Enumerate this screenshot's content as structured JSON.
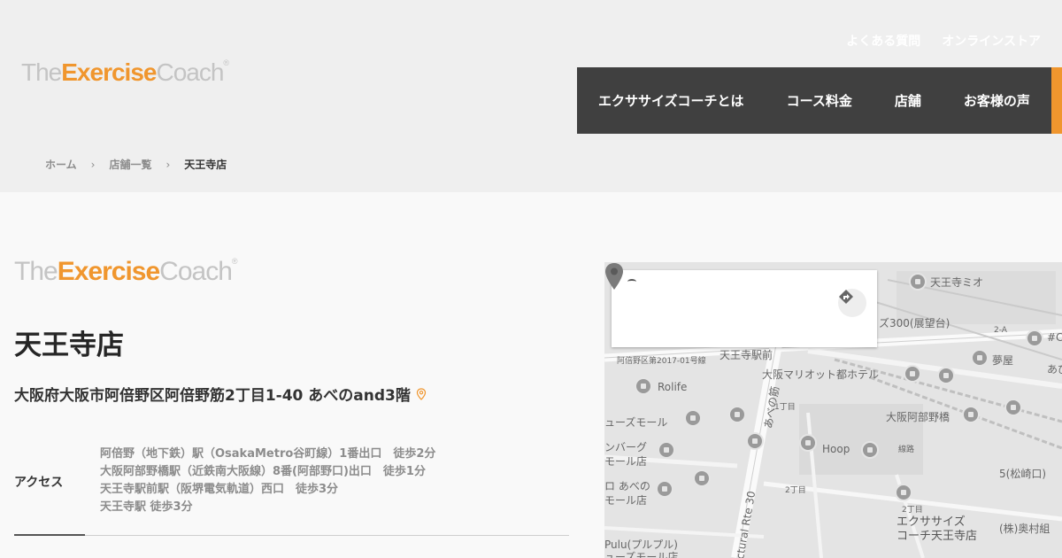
{
  "brand": {
    "the": "The",
    "exercise": "Exercise",
    "coach": "Coach",
    "reg": "®"
  },
  "util_nav": [
    "よくある質問",
    "オンラインストア"
  ],
  "main_nav": [
    "エクササイズコーチとは",
    "コース料金",
    "店舗",
    "お客様の声"
  ],
  "breadcrumb": {
    "home": "ホーム",
    "list": "店舗一覧",
    "current": "天王寺店",
    "sep": "›"
  },
  "store": {
    "name": "天王寺店",
    "address": "大阪府大阪市阿倍野区阿倍野筋2丁目1-40 あべのand3階",
    "access_label": "アクセス",
    "access": [
      "阿倍野（地下鉄）駅（OsakaMetro谷町線）1番出口　徒歩2分",
      "大阪阿部野橋駅（近鉄南大阪線）8番(阿部野口)出口　徒歩1分",
      "天王寺駅前駅（阪堺電気軌道）西口　徒歩3分",
      "天王寺駅 徒歩3分"
    ]
  },
  "map": {
    "labels": {
      "tennoji_mio": "天王寺ミオ",
      "tenbodai": "ズ300(展望台)",
      "a2": "2-A",
      "a1": "#C",
      "yumeya": "夢屋",
      "abeno": "あび",
      "area_code": "阿倍野区第2017-01号線",
      "tennoji_ekimae": "天王寺駅前",
      "marriott": "大阪マリオット都ホテル",
      "rolife": "Rolife",
      "mall": "ューズモール",
      "itchome": "1丁目",
      "abenobashi": "大阪阿部野橋",
      "burger": "ンバーグ",
      "mall_store": "モール店",
      "hoop": "Hoop",
      "abenosuji": "あべの筋",
      "senro": "線路",
      "ko_abeno": "ロ あべの",
      "mall_store2": "モール店",
      "matsusakiguchi": "5(松崎口)",
      "nicho": "2丁目",
      "sancho": "3丁目",
      "coach_store_1": "エクササイズ",
      "coach_store_2": "コーチ天王寺店",
      "okumura": "(株)奥村組",
      "pulu": "Pulu(プルプル)",
      "route": "ctural Rte 30",
      "bottom_mall": "ューズモール店"
    }
  }
}
